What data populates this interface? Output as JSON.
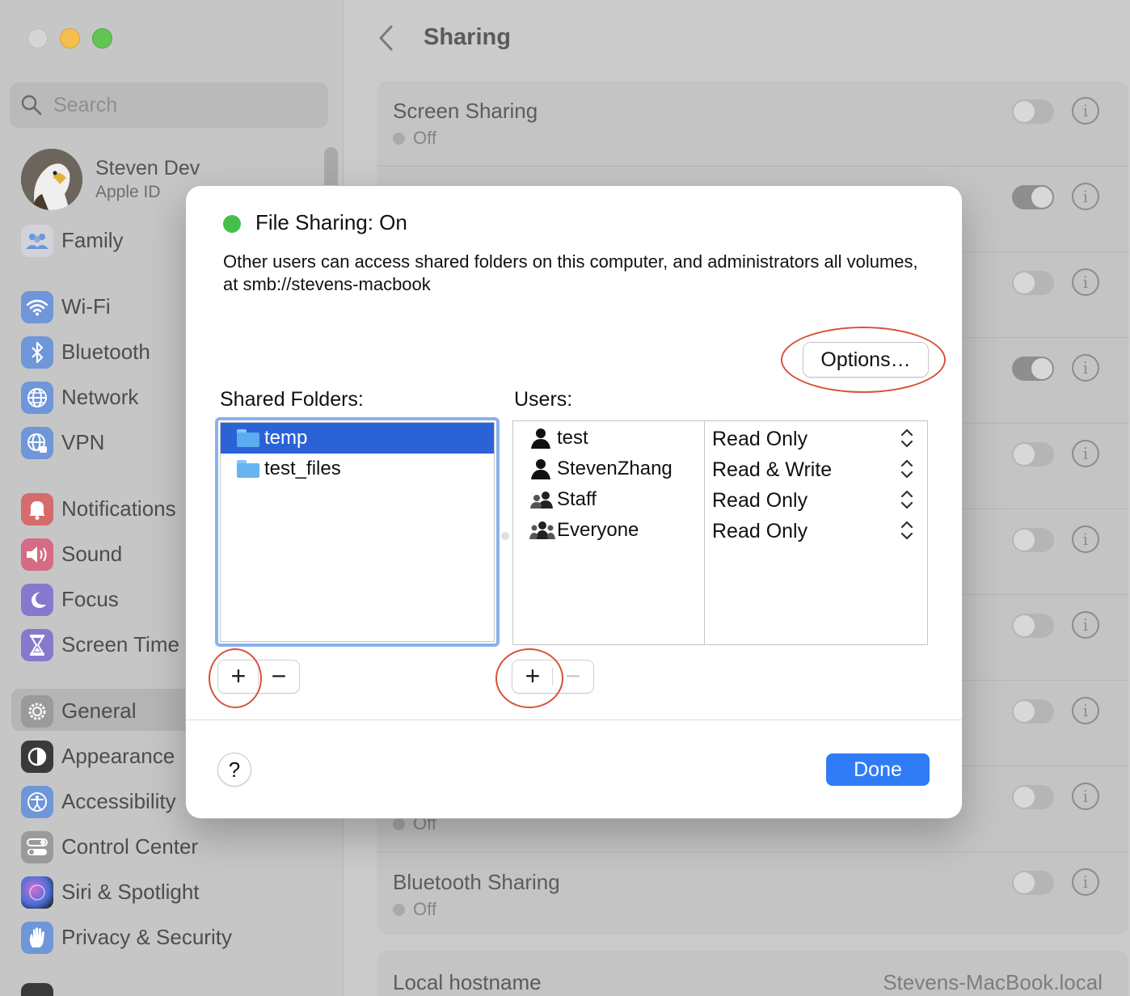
{
  "sidebar": {
    "search_placeholder": "Search",
    "user": {
      "name": "Steven Dev",
      "subtitle": "Apple ID"
    },
    "items": [
      {
        "label": "Family",
        "icon": "family-icon",
        "color": "#cfcfd6"
      },
      {
        "label": "Wi-Fi",
        "icon": "wifi-icon",
        "color": "#6e96d9"
      },
      {
        "label": "Bluetooth",
        "icon": "bluetooth-icon",
        "color": "#6e96d9"
      },
      {
        "label": "Network",
        "icon": "globe-icon",
        "color": "#6e96d9"
      },
      {
        "label": "VPN",
        "icon": "vpn-globe-icon",
        "color": "#6e96d9"
      },
      {
        "label": "Notifications",
        "icon": "bell-icon",
        "color": "#d56b6b"
      },
      {
        "label": "Sound",
        "icon": "speaker-icon",
        "color": "#d56b84"
      },
      {
        "label": "Focus",
        "icon": "moon-icon",
        "color": "#8678cc"
      },
      {
        "label": "Screen Time",
        "icon": "hourglass-icon",
        "color": "#8678cc"
      },
      {
        "label": "General",
        "icon": "gear-icon",
        "color": "#9a9a9a"
      },
      {
        "label": "Appearance",
        "icon": "appearance-icon",
        "color": "#3a3a3a"
      },
      {
        "label": "Accessibility",
        "icon": "accessibility-icon",
        "color": "#6e96d9"
      },
      {
        "label": "Control Center",
        "icon": "switches-icon",
        "color": "#9a9a9a"
      },
      {
        "label": "Siri & Spotlight",
        "icon": "siri-icon",
        "color": "#7a4fa8"
      },
      {
        "label": "Privacy & Security",
        "icon": "hand-icon",
        "color": "#6e96d9"
      }
    ]
  },
  "main": {
    "title": "Sharing",
    "rows": [
      {
        "title": "Screen Sharing",
        "status": "Off"
      },
      {
        "title": "",
        "status": ""
      },
      {
        "title": "",
        "status": ""
      },
      {
        "title": "",
        "status": ""
      },
      {
        "title": "",
        "status": ""
      },
      {
        "title": "",
        "status": ""
      },
      {
        "title": "",
        "status": ""
      },
      {
        "title": "",
        "status": ""
      },
      {
        "title": "",
        "status": "Off"
      },
      {
        "title": "Bluetooth Sharing",
        "status": "Off"
      }
    ],
    "hostname_label": "Local hostname",
    "hostname_value": "Stevens-MacBook.local"
  },
  "dialog": {
    "title": "File Sharing: On",
    "description": "Other users can access shared folders on this computer, and administrators all volumes, at smb://stevens-macbook",
    "options_label": "Options…",
    "shared_folders_label": "Shared Folders:",
    "users_label": "Users:",
    "folders": [
      "temp",
      "test_files"
    ],
    "users": [
      {
        "name": "test",
        "permission": "Read Only",
        "icon": "person-icon"
      },
      {
        "name": "StevenZhang",
        "permission": "Read & Write",
        "icon": "person-icon"
      },
      {
        "name": "Staff",
        "permission": "Read Only",
        "icon": "group-icon"
      },
      {
        "name": "Everyone",
        "permission": "Read Only",
        "icon": "group-large-icon"
      }
    ],
    "plus": "+",
    "minus": "−",
    "help": "?",
    "done_label": "Done"
  }
}
